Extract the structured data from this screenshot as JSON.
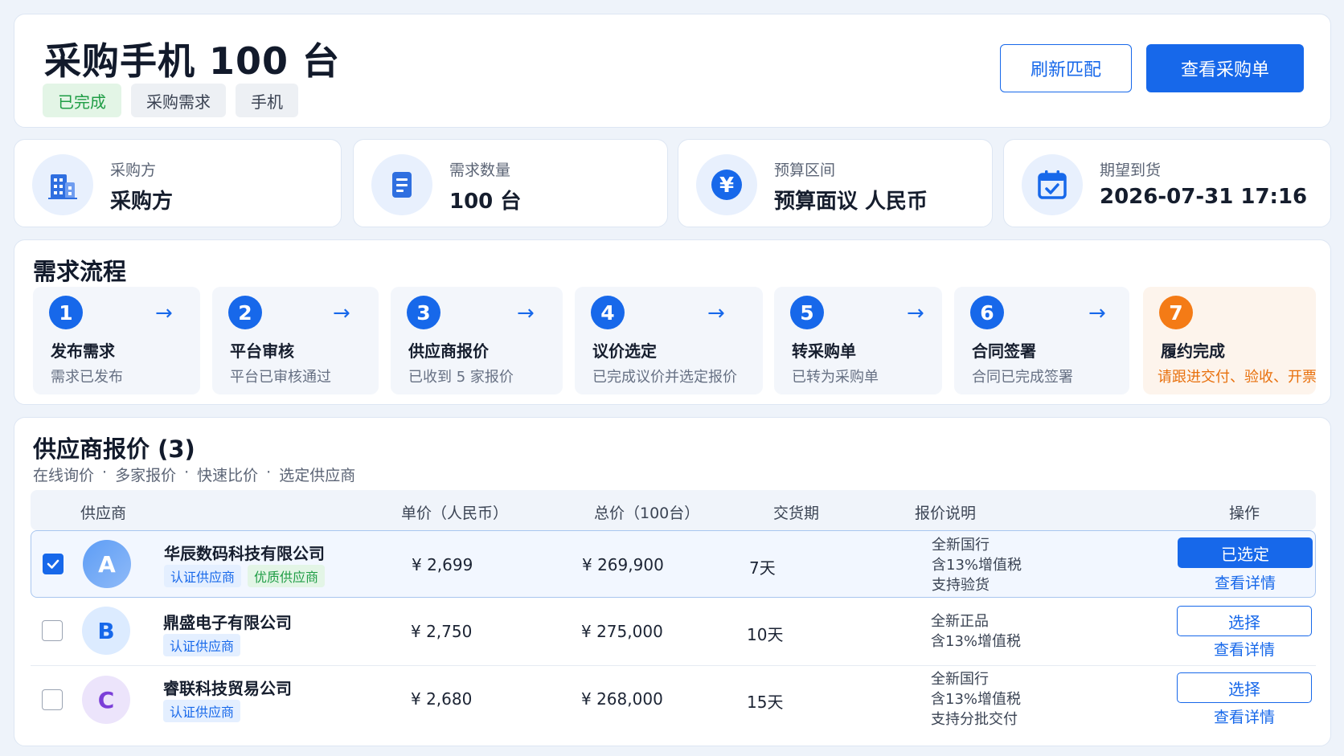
{
  "header": {
    "title": "采购手机 100 台",
    "tags": [
      "已完成",
      "采购需求",
      "手机"
    ],
    "refresh_label": "刷新匹配",
    "view_order_label": "查看采购单"
  },
  "stats": [
    {
      "label": "采购方",
      "value": "采购方",
      "icon": "building-icon"
    },
    {
      "label": "需求数量",
      "value": "100 台",
      "icon": "document-icon"
    },
    {
      "label": "预算区间",
      "value": "预算面议 人民币",
      "icon": "yuan-icon"
    },
    {
      "label": "期望到货",
      "value": "2026-07-31 17:16",
      "icon": "calendar-icon"
    }
  ],
  "flow": {
    "title": "需求流程",
    "steps": [
      {
        "num": "1",
        "title": "发布需求",
        "desc": "需求已发布"
      },
      {
        "num": "2",
        "title": "平台审核",
        "desc": "平台已审核通过"
      },
      {
        "num": "3",
        "title": "供应商报价",
        "desc": "已收到 5 家报价"
      },
      {
        "num": "4",
        "title": "议价选定",
        "desc": "已完成议价并选定报价"
      },
      {
        "num": "5",
        "title": "转采购单",
        "desc": "已转为采购单"
      },
      {
        "num": "6",
        "title": "合同签署",
        "desc": "合同已完成签署"
      },
      {
        "num": "7",
        "title": "履约完成",
        "desc": "请跟进交付、验收、开票"
      }
    ],
    "arrow": "→"
  },
  "quotes": {
    "title": "供应商报价 (3)",
    "subtitle": [
      "在线询价",
      "多家报价",
      "快速比价",
      "选定供应商"
    ],
    "columns": {
      "supplier": "供应商",
      "unit_price": "单价（人民币）",
      "total_price": "总价（100台）",
      "delivery": "交货期",
      "note": "报价说明",
      "action": "操作"
    },
    "rows": [
      {
        "checked": true,
        "avatar": "A",
        "name": "华辰数码科技有限公司",
        "badges": [
          "认证供应商",
          "优质供应商"
        ],
        "unit_price": "¥ 2,699",
        "total_price": "¥ 269,900",
        "delivery": "7天",
        "notes": [
          "全新国行",
          "含13%增值税",
          "支持验货"
        ],
        "action": "已选定",
        "detail": "查看详情"
      },
      {
        "checked": false,
        "avatar": "B",
        "name": "鼎盛电子有限公司",
        "badges": [
          "认证供应商"
        ],
        "unit_price": "¥ 2,750",
        "total_price": "¥ 275,000",
        "delivery": "10天",
        "notes": [
          "全新正品",
          "含13%增值税"
        ],
        "action": "选择",
        "detail": "查看详情"
      },
      {
        "checked": false,
        "avatar": "C",
        "name": "睿联科技贸易公司",
        "badges": [
          "认证供应商"
        ],
        "unit_price": "¥ 2,680",
        "total_price": "¥ 268,000",
        "delivery": "15天",
        "notes": [
          "全新国行",
          "含13%增值税",
          "支持分批交付"
        ],
        "action": "选择",
        "detail": "查看详情"
      }
    ]
  },
  "colors": {
    "primary": "#1768ea",
    "success": "#1f9d45",
    "warning": "#f47b16"
  }
}
